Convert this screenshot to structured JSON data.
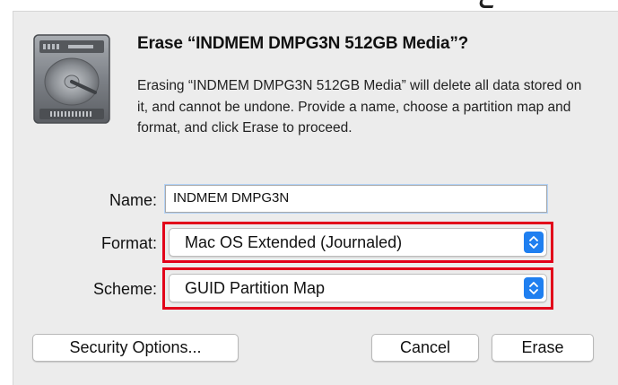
{
  "dialog": {
    "title": "Erase “INDMEM DMPG3N 512GB Media”?",
    "description": "Erasing  “INDMEM DMPG3N 512GB Media”  will delete all data stored on it, and cannot be undone. Provide a name, choose a partition map and format, and click Erase to proceed.",
    "name_label": "Name:",
    "name_value": "INDMEM DMPG3N",
    "format_label": "Format:",
    "format_value": "Mac OS Extended (Journaled)",
    "scheme_label": "Scheme:",
    "scheme_value": "GUID Partition Map"
  },
  "buttons": {
    "security_options": "Security Options...",
    "cancel": "Cancel",
    "erase": "Erase"
  },
  "icons": {
    "drive": "hard-drive-icon",
    "popup_arrows": "chevron-updown-icon"
  },
  "colors": {
    "highlight": "#e2001a",
    "accent": "#1f7ff0"
  }
}
